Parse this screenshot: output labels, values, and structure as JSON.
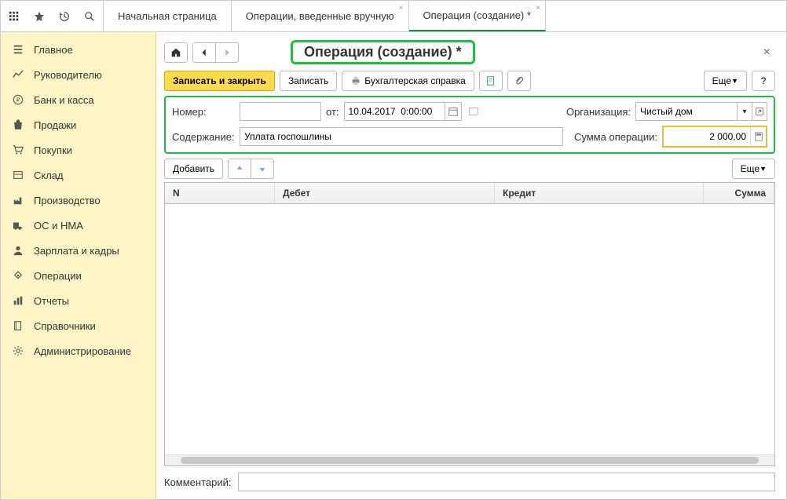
{
  "toolbar": {
    "tabs": [
      {
        "label": "Начальная страница"
      },
      {
        "label": "Операции, введенные вручную"
      },
      {
        "label": "Операция (создание) *"
      }
    ]
  },
  "sidebar": {
    "items": [
      {
        "label": "Главное",
        "icon": "menu"
      },
      {
        "label": "Руководителю",
        "icon": "chart"
      },
      {
        "label": "Банк и касса",
        "icon": "ruble"
      },
      {
        "label": "Продажи",
        "icon": "bag"
      },
      {
        "label": "Покупки",
        "icon": "cart"
      },
      {
        "label": "Склад",
        "icon": "box"
      },
      {
        "label": "Производство",
        "icon": "factory"
      },
      {
        "label": "ОС и НМА",
        "icon": "truck"
      },
      {
        "label": "Зарплата и кадры",
        "icon": "person"
      },
      {
        "label": "Операции",
        "icon": "diamond"
      },
      {
        "label": "Отчеты",
        "icon": "bars"
      },
      {
        "label": "Справочники",
        "icon": "book"
      },
      {
        "label": "Администрирование",
        "icon": "gear"
      }
    ]
  },
  "page": {
    "title": "Операция (создание) *",
    "buttons": {
      "save_close": "Записать и закрыть",
      "save": "Записать",
      "print": "Бухгалтерская справка",
      "more": "Еще",
      "add": "Добавить",
      "more2": "Еще"
    },
    "form": {
      "number_label": "Номер:",
      "number_value": "",
      "date_label": "от:",
      "date_value": "10.04.2017  0:00:00",
      "org_label": "Организация:",
      "org_value": "Чистый дом",
      "content_label": "Содержание:",
      "content_value": "Уплата госпошлины",
      "sum_label": "Сумма операции:",
      "sum_value": "2 000,00"
    },
    "table": {
      "columns": {
        "n": "N",
        "debit": "Дебет",
        "credit": "Кредит",
        "sum": "Сумма"
      }
    },
    "comment_label": "Комментарий:",
    "comment_value": ""
  }
}
